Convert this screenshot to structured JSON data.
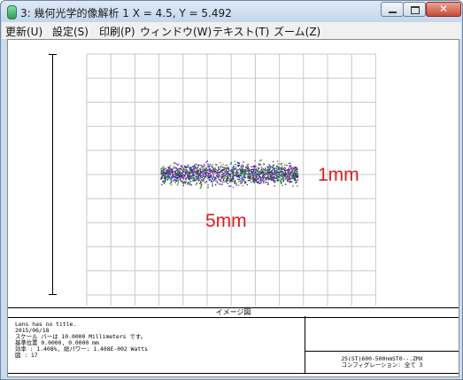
{
  "window": {
    "title": "3: 幾何光学的像解析 1 X = 4.5, Y = 5.492",
    "controls": {
      "close_glyph": "✕"
    }
  },
  "menu": [
    {
      "label": "更新(U)"
    },
    {
      "label": "設定(S)"
    },
    {
      "label": "印刷(P)"
    },
    {
      "label": "ウィンドウ(W)"
    },
    {
      "label": "テキスト(T)"
    },
    {
      "label": "ズーム(Z)"
    }
  ],
  "plot": {
    "grid": true,
    "grid_color": "#c8c8c8",
    "spot_colors": [
      "#2ab02a",
      "#1e2bd8",
      "#7a16b8",
      "#d12fd1",
      "#1a8a1a",
      "#333333"
    ]
  },
  "annotations": {
    "height_label": "1mm",
    "width_label": "5mm",
    "color": "#e01b1b"
  },
  "footer": {
    "title": "イメージ図",
    "lines": [
      "Lens has no title.",
      "2015/06/18",
      "スケール バーは 10.0000 Millimeters です。",
      "基準位置          0.0000, 0.0000 mm",
      "効率   :    1.408%, 総パワー:  1.408E-002 Watts",
      "図   :    17"
    ],
    "file": "25(ST)600-500nmST0--.ZMX",
    "config": "コンフィグレーション: 全て 3"
  }
}
